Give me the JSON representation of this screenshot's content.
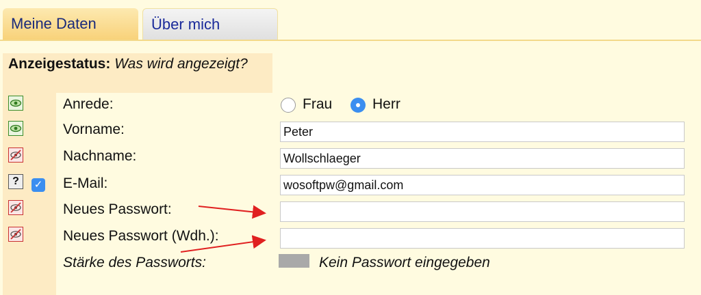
{
  "tabs": [
    {
      "label": "Meine Daten",
      "active": true
    },
    {
      "label": "Über mich",
      "active": false
    }
  ],
  "status_header": {
    "title": "Anzeigestatus:",
    "question": "Was wird angezeigt?"
  },
  "form": {
    "anrede": {
      "label": "Anrede:",
      "options": [
        {
          "label": "Frau",
          "selected": false
        },
        {
          "label": "Herr",
          "selected": true
        }
      ]
    },
    "vorname": {
      "label": "Vorname:",
      "value": "Peter"
    },
    "nachname": {
      "label": "Nachname:",
      "value": "Wollschlaeger"
    },
    "email": {
      "label": "E-Mail:",
      "value": "wosoftpw@gmail.com",
      "checked": true
    },
    "neues_passwort": {
      "label": "Neues Passwort:",
      "value": ""
    },
    "neues_passwort_wdh": {
      "label": "Neues Passwort (Wdh.):",
      "value": ""
    },
    "staerke": {
      "label": "Stärke des Passworts:",
      "status": "Kein Passwort eingegeben"
    }
  },
  "icons": {
    "visible": "eye-icon",
    "hidden": "eye-crossed-icon",
    "unknown": "question-icon"
  },
  "colors": {
    "accent": "#3b8ef0",
    "tab_active": "#f8d27a",
    "panel": "#fdebc4",
    "arrow": "#e02020"
  }
}
